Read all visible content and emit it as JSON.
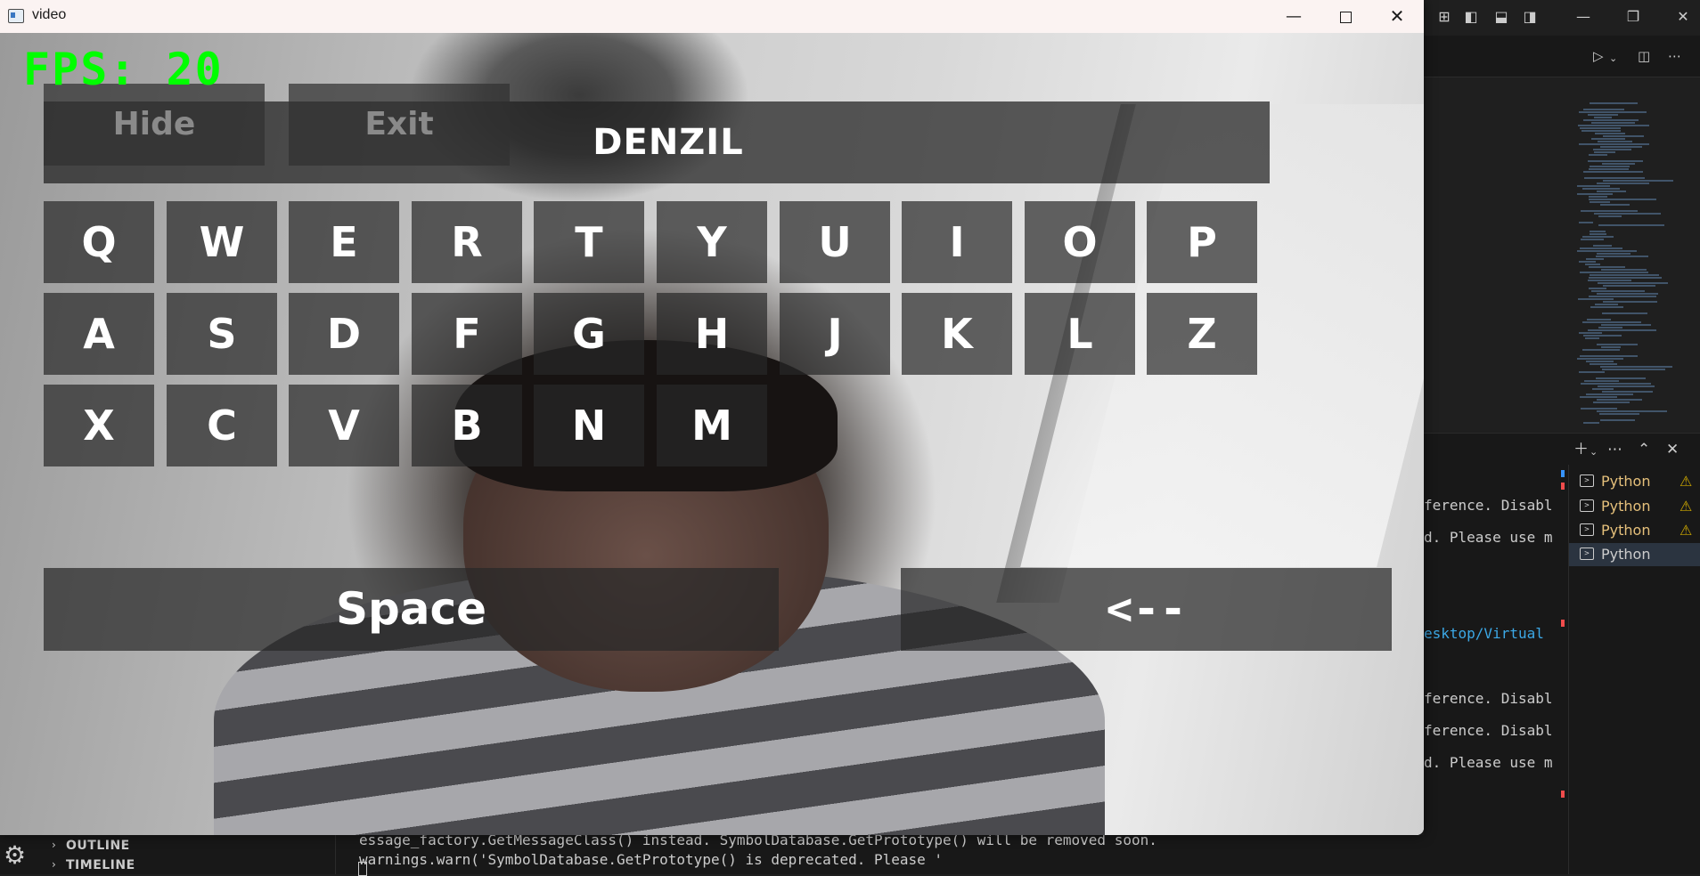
{
  "window": {
    "title": "video"
  },
  "overlay": {
    "fps_text": "FPS: 20",
    "typed_text": "DENZIL",
    "hide_label": "Hide",
    "exit_label": "Exit",
    "space_label": "Space",
    "backspace_label": "<--"
  },
  "keyboard": {
    "row1": [
      "Q",
      "W",
      "E",
      "R",
      "T",
      "Y",
      "U",
      "I",
      "O",
      "P"
    ],
    "row2": [
      "A",
      "S",
      "D",
      "F",
      "G",
      "H",
      "J",
      "K",
      "L",
      "Z"
    ],
    "row3": [
      "X",
      "C",
      "V",
      "B",
      "N",
      "M"
    ]
  },
  "vscode": {
    "terminal_lines": [
      "ference. Disabl",
      "d. Please use m",
      "esktop/Virtual",
      "ference. Disabl",
      "ference. Disabl",
      "d. Please use m"
    ],
    "terminals": [
      {
        "label": "Python",
        "warning": true
      },
      {
        "label": "Python",
        "warning": true
      },
      {
        "label": "Python",
        "warning": true
      },
      {
        "label": "Python",
        "warning": false
      }
    ],
    "sidebar_sections": [
      "OUTLINE",
      "TIMELINE"
    ],
    "bottom_terminal_lines": [
      "essage_factory.GetMessageClass() instead. SymbolDatabase.GetPrototype() will be removed soon.",
      "  warnings.warn('SymbolDatabase.GetPrototype() is deprecated. Please '"
    ]
  },
  "colors": {
    "fps_green": "#00ff00",
    "warning_yellow": "#cca700",
    "python_terminal_yellow": "#e5c07b",
    "link_blue": "#3ca8e6"
  }
}
